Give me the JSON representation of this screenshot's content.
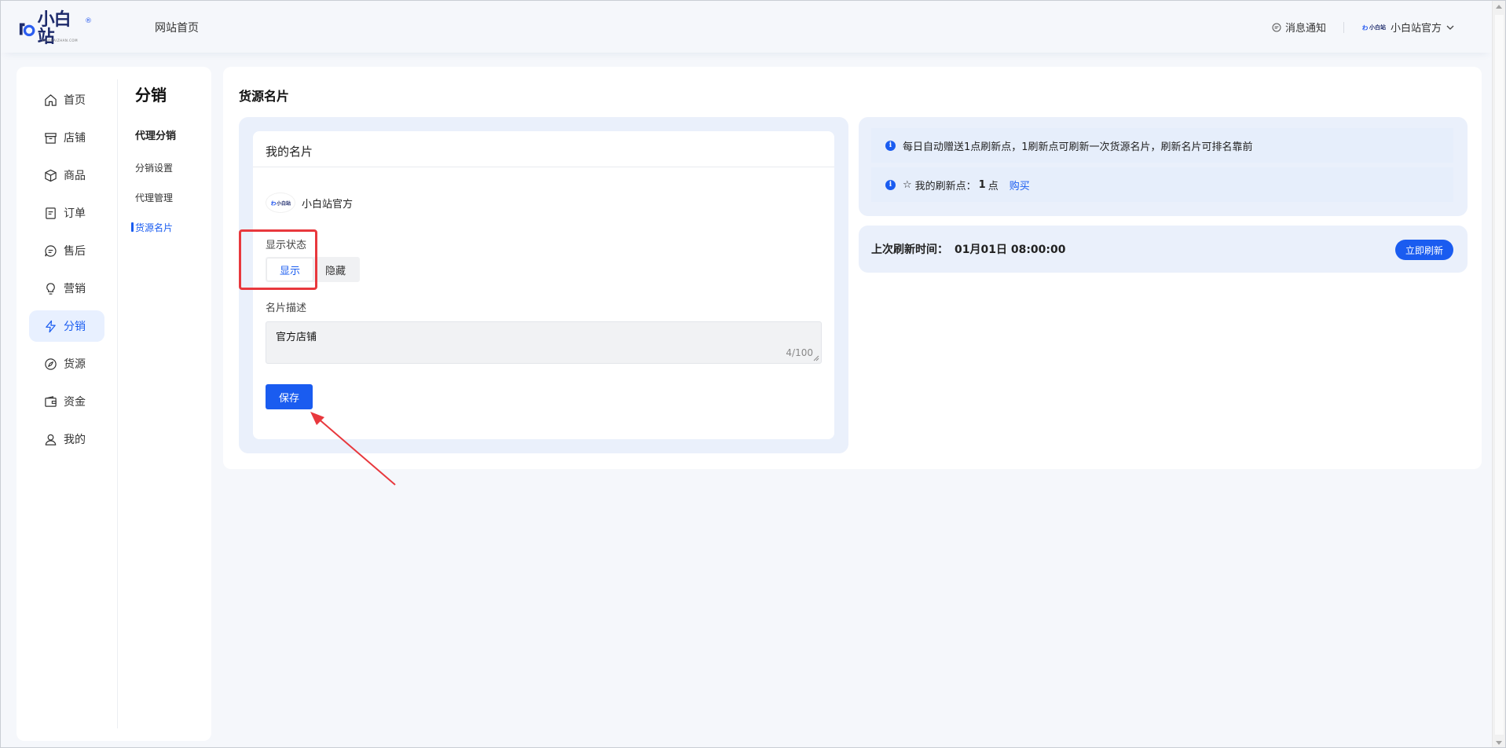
{
  "header": {
    "logo_text": "小白站",
    "logo_reg": "®",
    "logo_sub": "XIAOBAIZHAN.COM",
    "nav_home": "网站首页",
    "message": "消息通知",
    "user_logo": "小白站",
    "user_name": "小白站官方"
  },
  "sidebar": {
    "menu": [
      {
        "label": "首页",
        "icon": "home-icon"
      },
      {
        "label": "店铺",
        "icon": "store-icon"
      },
      {
        "label": "商品",
        "icon": "box-icon"
      },
      {
        "label": "订单",
        "icon": "order-icon"
      },
      {
        "label": "售后",
        "icon": "chat-icon"
      },
      {
        "label": "营销",
        "icon": "bulb-icon"
      },
      {
        "label": "分销",
        "icon": "bolt-icon",
        "active": true
      },
      {
        "label": "货源",
        "icon": "compass-icon"
      },
      {
        "label": "资金",
        "icon": "wallet-icon"
      },
      {
        "label": "我的",
        "icon": "user-icon"
      }
    ],
    "sub_title": "分销",
    "sub_group": "代理分销",
    "sub_items": [
      {
        "label": "分销设置"
      },
      {
        "label": "代理管理"
      },
      {
        "label": "货源名片",
        "active": true
      }
    ]
  },
  "main": {
    "page_title": "货源名片",
    "card_title": "我的名片",
    "shop_name": "小白站官方",
    "status_label": "显示状态",
    "status_options": [
      "显示",
      "隐藏"
    ],
    "status_selected": "显示",
    "desc_label": "名片描述",
    "desc_value": "官方店铺",
    "desc_counter": "4/100",
    "save_label": "保存"
  },
  "info": {
    "notice": "每日自动赠送1点刷新点，1刷新点可刷新一次货源名片，刷新名片可排名靠前",
    "points_label": "我的刷新点：",
    "points_value": "1",
    "points_unit": "点",
    "buy_label": "购买",
    "last_refresh_label": "上次刷新时间：",
    "last_refresh_value": "01月01日 08:00:00",
    "refresh_label": "立即刷新"
  },
  "colors": {
    "accent": "#1a5cf0",
    "annotation": "#e8383d",
    "panel_bg": "#eaf0fb"
  }
}
